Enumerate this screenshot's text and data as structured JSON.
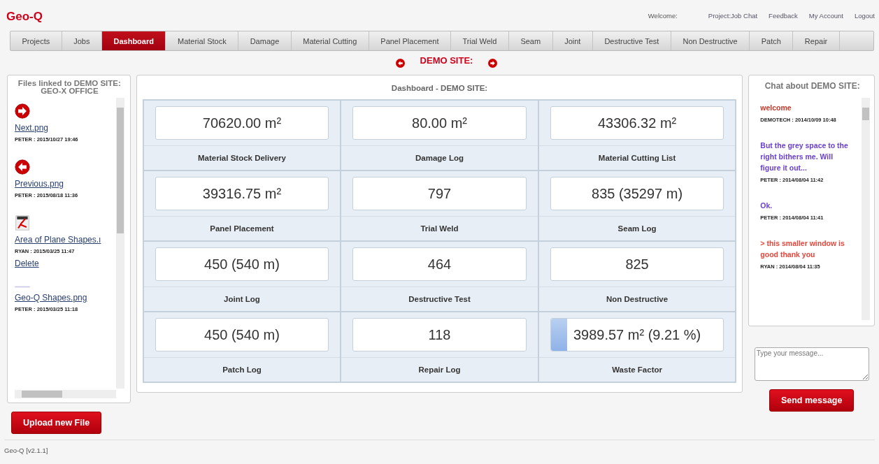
{
  "app": {
    "logo": "Geo-Q",
    "version": "Geo-Q [v2.1.1]"
  },
  "header_links": {
    "welcome": "Welcome:",
    "links": [
      "Project:Job Chat",
      "Feedback",
      "My Account",
      "Logout"
    ]
  },
  "tabs": [
    {
      "label": "Projects",
      "selected": false
    },
    {
      "label": "Jobs",
      "selected": false
    },
    {
      "label": "Dashboard",
      "selected": true
    },
    {
      "label": "Material Stock",
      "selected": false
    },
    {
      "label": "Damage",
      "selected": false
    },
    {
      "label": "Material Cutting",
      "selected": false
    },
    {
      "label": "Panel Placement",
      "selected": false
    },
    {
      "label": "Trial Weld",
      "selected": false
    },
    {
      "label": "Seam",
      "selected": false
    },
    {
      "label": "Joint",
      "selected": false
    },
    {
      "label": "Destructive Test",
      "selected": false
    },
    {
      "label": "Non Destructive",
      "selected": false
    },
    {
      "label": "Patch",
      "selected": false
    },
    {
      "label": "Repair",
      "selected": false
    }
  ],
  "site_nav": {
    "title": "DEMO SITE:"
  },
  "files_panel": {
    "title": "Files linked to DEMO SITE: GEO-X OFFICE",
    "files": [
      {
        "kind": "next",
        "name": "Next.png",
        "meta": "PETER : 2015/10/27 19:46"
      },
      {
        "kind": "previous",
        "name": "Previous.png",
        "meta": "PETER : 2015/08/18 11:36"
      },
      {
        "kind": "pdf",
        "name": "Area of Plane Shapes.ı",
        "meta": "RYAN : 2015/03/25 11:47",
        "delete": "Delete"
      },
      {
        "kind": "broken",
        "name": "Geo-Q Shapes.png",
        "meta": "PETER : 2015/03/25 11:18"
      }
    ],
    "upload_button": "Upload new File"
  },
  "dashboard": {
    "title": "Dashboard - DEMO SITE:",
    "tiles": [
      {
        "value": "70620.00 m²",
        "label": "Material Stock Delivery"
      },
      {
        "value": "80.00 m²",
        "label": "Damage Log"
      },
      {
        "value": "43306.32 m²",
        "label": "Material Cutting List"
      },
      {
        "value": "39316.75 m²",
        "label": "Panel Placement"
      },
      {
        "value": "797",
        "label": "Trial Weld"
      },
      {
        "value": "835 (35297 m)",
        "label": "Seam Log"
      },
      {
        "value": "450 (540 m)",
        "label": "Joint Log"
      },
      {
        "value": "464",
        "label": "Destructive Test"
      },
      {
        "value": "825",
        "label": "Non Destructive"
      },
      {
        "value": "450 (540 m)",
        "label": "Patch Log"
      },
      {
        "value": "118",
        "label": "Repair Log"
      },
      {
        "value": "3989.57 m² (9.21 %)",
        "label": "Waste Factor",
        "level": 0.0921
      }
    ]
  },
  "chat": {
    "title": "Chat about DEMO SITE:",
    "messages": [
      {
        "text": "welcome",
        "meta": "DEMOTECH : 2014/10/09 10:48",
        "color": "#c0392b"
      },
      {
        "text": "But the grey space to the right bithers me. Will figure it out...",
        "meta": "PETER : 2014/08/04 11:42",
        "color": "#6a3fd0"
      },
      {
        "text": "Ok.",
        "meta": "PETER : 2014/08/04 11:41",
        "color": "#6a3fd0"
      },
      {
        "text": "> this smaller window is good thank you",
        "meta": "RYAN : 2014/08/04 11:35",
        "color": "#e8463c"
      }
    ],
    "placeholder": "Type your message...",
    "send_button": "Send message"
  }
}
